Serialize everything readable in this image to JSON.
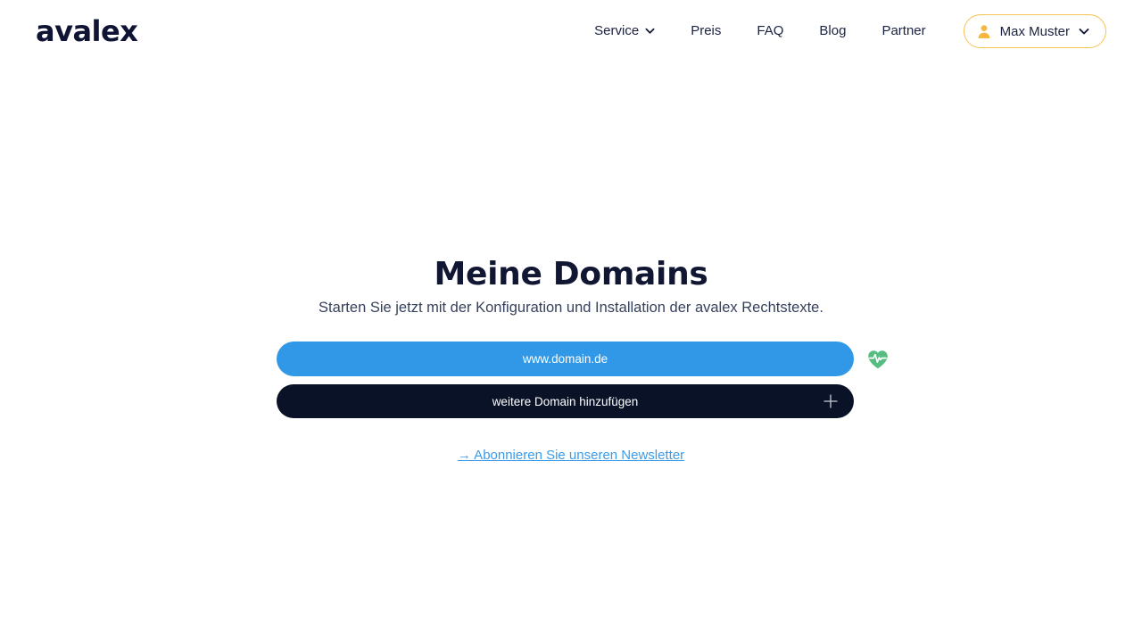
{
  "brand": {
    "logo_text": "avalex",
    "logo_color": "#101434"
  },
  "header": {
    "nav_items": [
      {
        "label": "Service",
        "has_chevron": true,
        "icon": "chevron-down-icon"
      },
      {
        "label": "Preis",
        "has_chevron": false
      },
      {
        "label": "FAQ",
        "has_chevron": false
      },
      {
        "label": "Blog",
        "has_chevron": false
      },
      {
        "label": "Partner",
        "has_chevron": false
      }
    ],
    "user_menu": {
      "name": "Max Muster",
      "person_icon": "person-icon",
      "chevron_icon": "chevron-down-icon",
      "border_color": "#f6c253",
      "icon_color": "#f5b841"
    }
  },
  "main": {
    "title": "Meine Domains",
    "subtitle": "Starten Sie jetzt mit der Konfiguration und Installation der avalex Rechtstexte.",
    "domains": [
      {
        "name": "www.domain.de",
        "color": "#3098e6",
        "status_icon": "heart-pulse-icon",
        "status_color": "#55bd7f"
      }
    ],
    "add_domain": {
      "label": "weitere Domain hinzufügen",
      "icon": "plus-icon",
      "color": "#0a1227"
    },
    "newsletter": {
      "label": "→ Abonnieren Sie unseren Newsletter",
      "color": "#3c9be8"
    }
  }
}
